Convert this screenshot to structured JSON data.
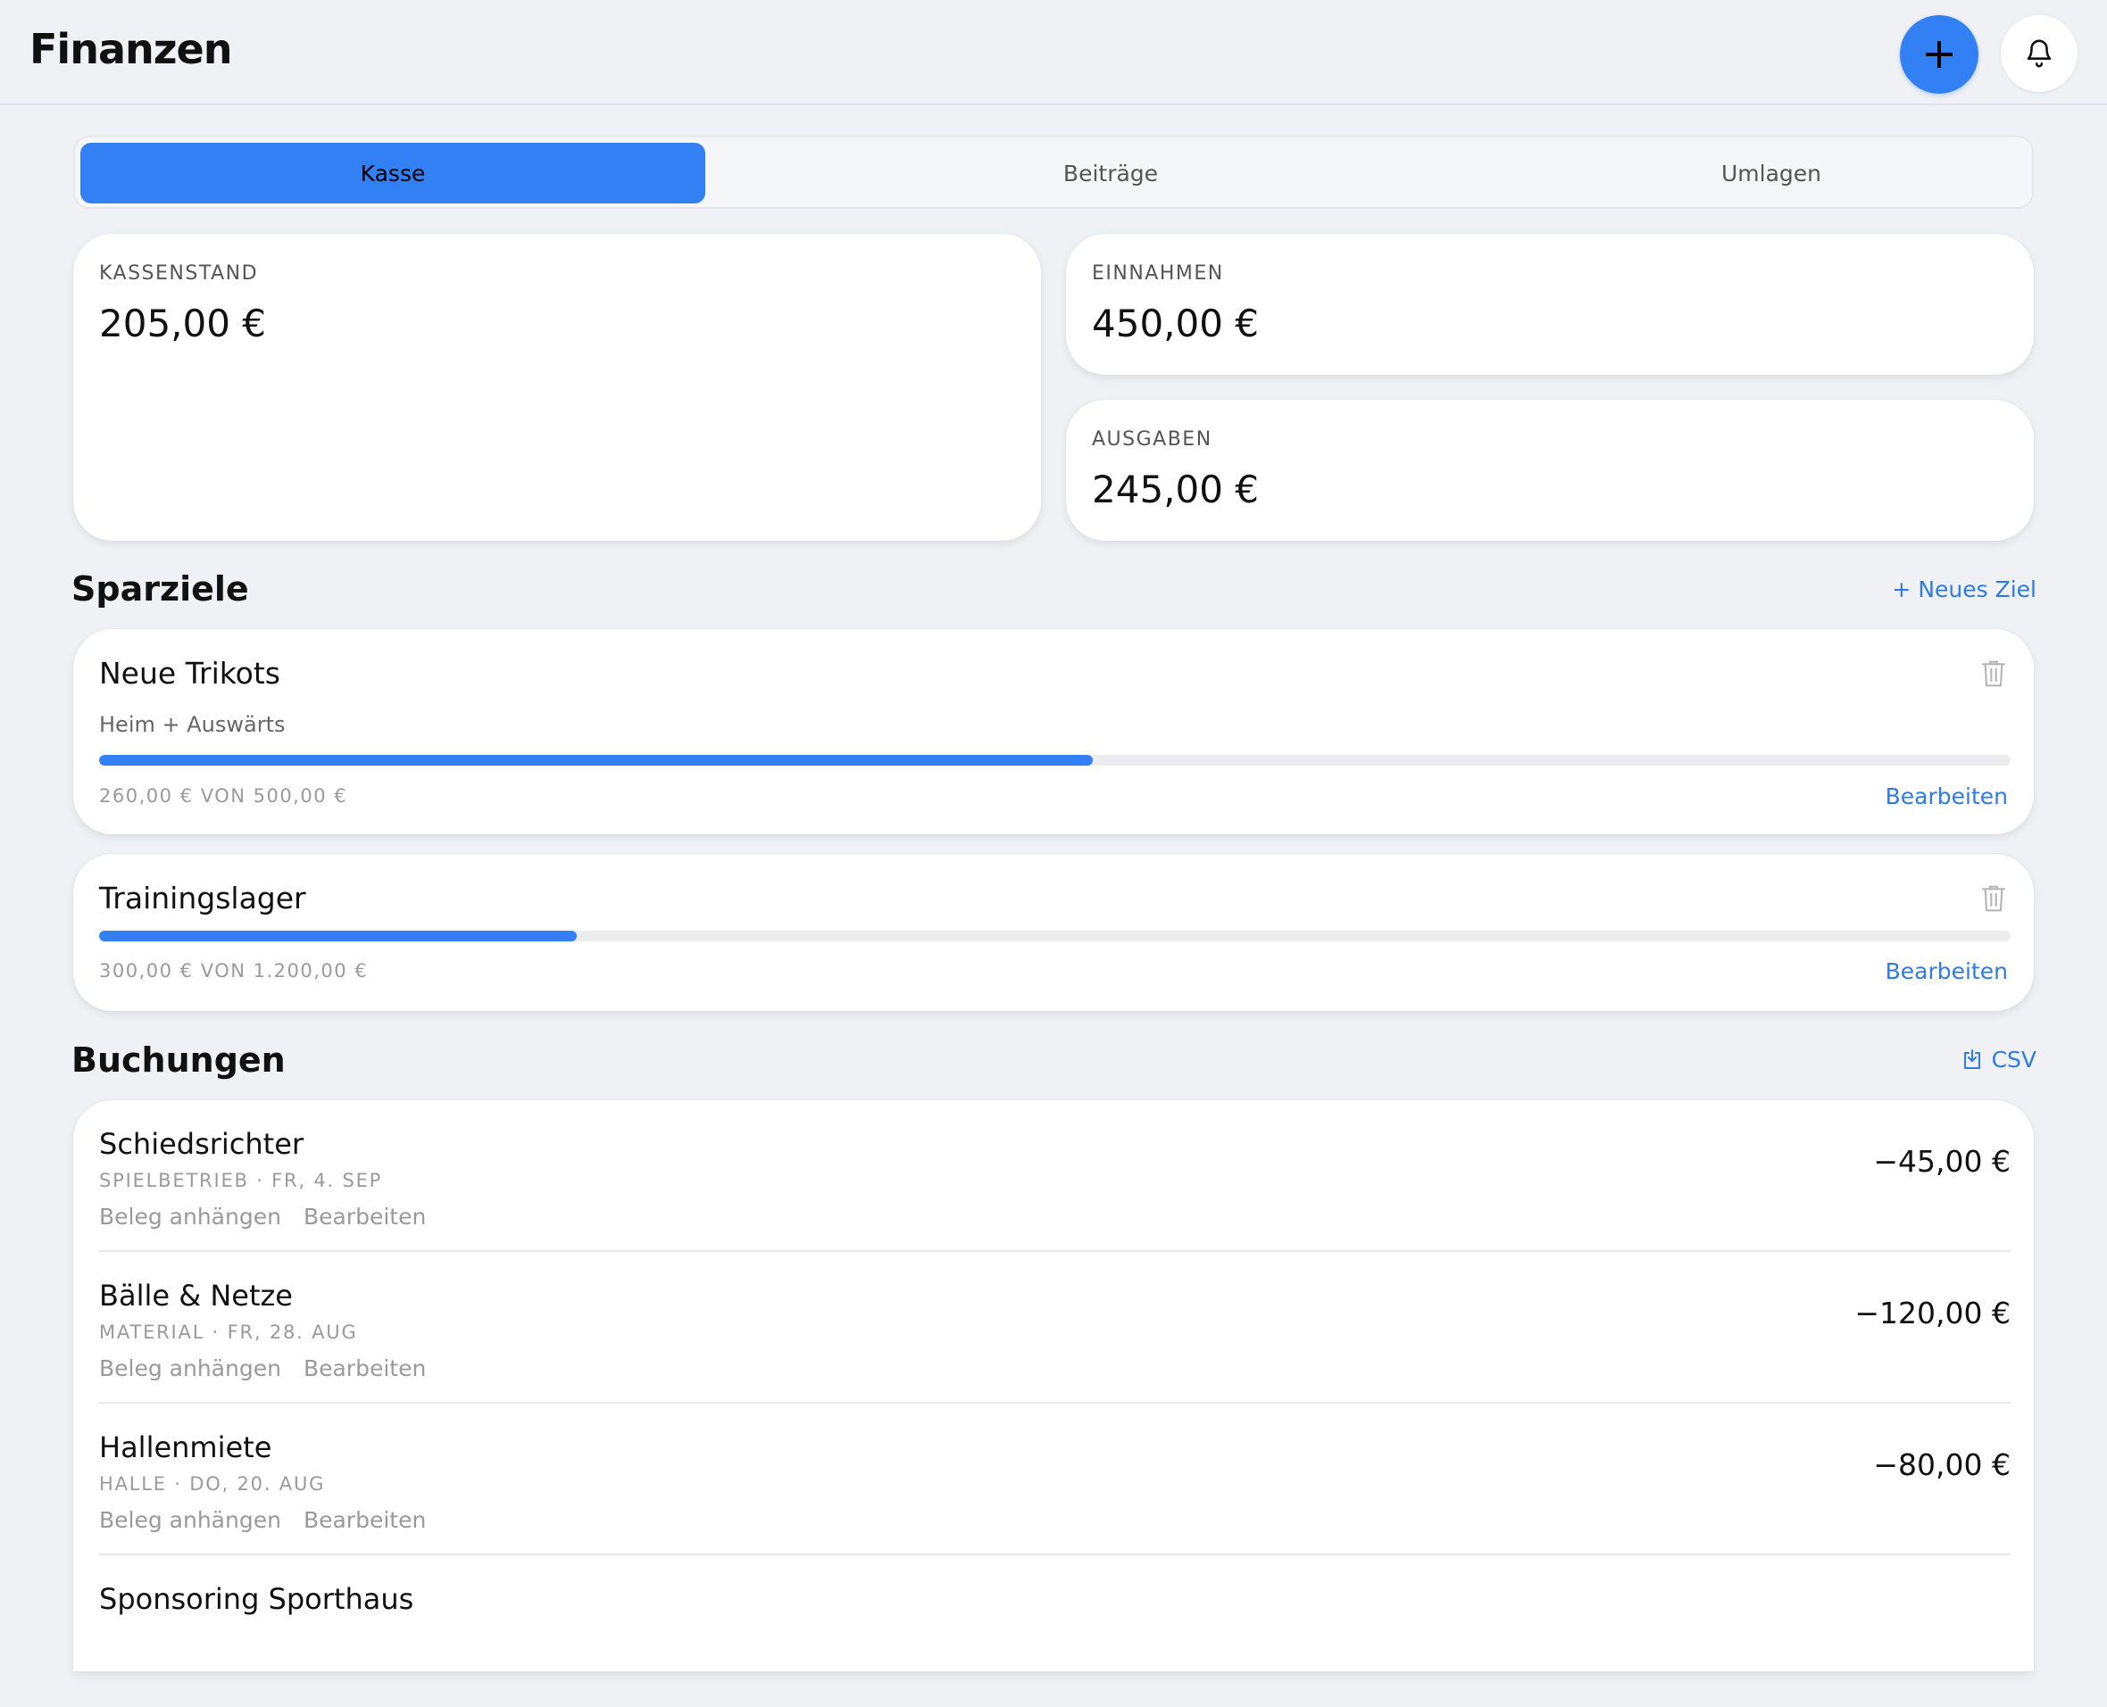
{
  "header": {
    "title": "Finanzen"
  },
  "tabs": [
    {
      "label": "Kasse"
    },
    {
      "label": "Beiträge"
    },
    {
      "label": "Umlagen"
    }
  ],
  "stats": {
    "balance": {
      "label": "KASSENSTAND",
      "value": "205,00 €"
    },
    "income": {
      "label": "EINNAHMEN",
      "value": "450,00 €"
    },
    "expenses": {
      "label": "AUSGABEN",
      "value": "245,00 €"
    }
  },
  "goals_section": {
    "title": "Sparziele",
    "new_goal_label": "+ Neues Ziel"
  },
  "goals": [
    {
      "name": "Neue Trikots",
      "description": "Heim + Auswärts",
      "amount_text": "260,00 € VON 500,00 €",
      "progress": 0.52,
      "edit_label": "Bearbeiten"
    },
    {
      "name": "Trainingslager",
      "amount_text": "300,00 € VON 1.200,00 €",
      "progress": 0.25,
      "edit_label": "Bearbeiten"
    }
  ],
  "bookings_section": {
    "title": "Buchungen",
    "csv_label": "CSV"
  },
  "bookings": [
    {
      "name": "Schiedsrichter",
      "meta": "SPIELBETRIEB · FR, 4. SEP",
      "amount": "−45,00 €",
      "attach_label": "Beleg anhängen",
      "edit_label": "Bearbeiten"
    },
    {
      "name": "Bälle & Netze",
      "meta": "MATERIAL · FR, 28. AUG",
      "amount": "−120,00 €",
      "attach_label": "Beleg anhängen",
      "edit_label": "Bearbeiten"
    },
    {
      "name": "Hallenmiete",
      "meta": "HALLE · DO, 20. AUG",
      "amount": "−80,00 €",
      "attach_label": "Beleg anhängen",
      "edit_label": "Bearbeiten"
    },
    {
      "name": "Sponsoring Sporthaus"
    }
  ],
  "colors": {
    "accent": "#3380f5",
    "link": "#2f7ae3",
    "background": "#f0f1f4"
  }
}
